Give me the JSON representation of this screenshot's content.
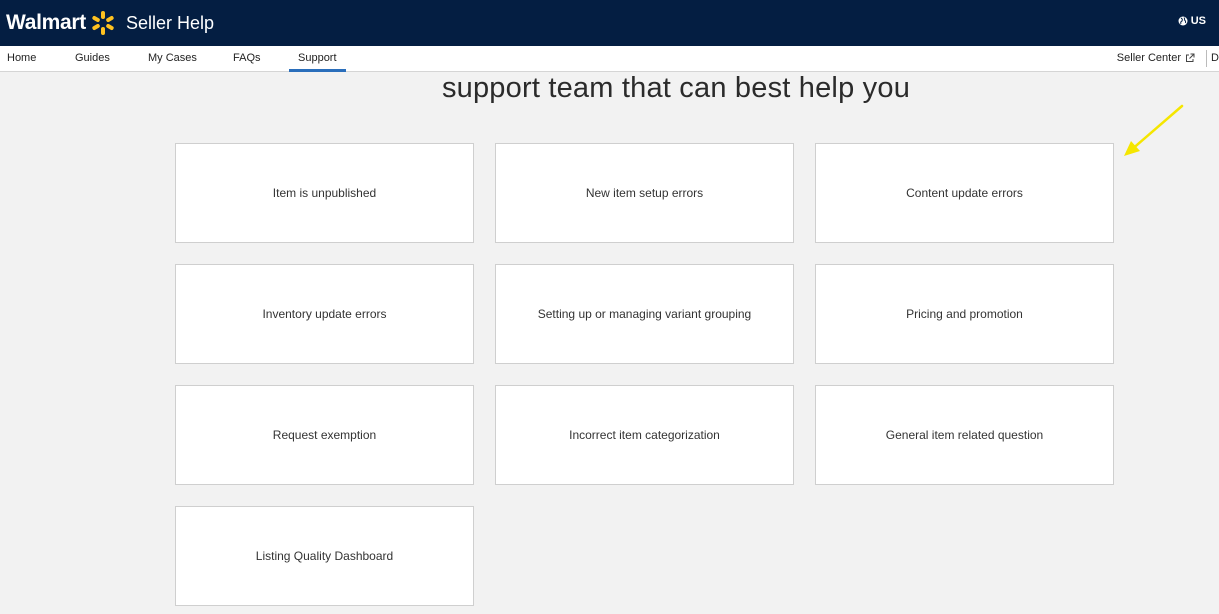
{
  "header": {
    "brand_name": "Walmart",
    "product_name": "Seller Help",
    "locale": "US",
    "brand_color": "#041e42",
    "spark_color": "#ffc220"
  },
  "nav": {
    "items": [
      {
        "label": "Home"
      },
      {
        "label": "Guides"
      },
      {
        "label": "My Cases"
      },
      {
        "label": "FAQs"
      },
      {
        "label": "Support"
      }
    ],
    "active": "Support",
    "seller_center": "Seller Center",
    "cut_off_item": "D"
  },
  "main": {
    "heading": "support team that can best help you",
    "cards": [
      {
        "label": "Item is unpublished"
      },
      {
        "label": "New item setup errors"
      },
      {
        "label": "Content update errors"
      },
      {
        "label": "Inventory update errors"
      },
      {
        "label": "Setting up or managing variant grouping"
      },
      {
        "label": "Pricing and promotion"
      },
      {
        "label": "Request exemption"
      },
      {
        "label": "Incorrect item categorization"
      },
      {
        "label": "General item related question"
      },
      {
        "label": "Listing Quality Dashboard"
      }
    ]
  },
  "annotation_color": "#f5e600"
}
